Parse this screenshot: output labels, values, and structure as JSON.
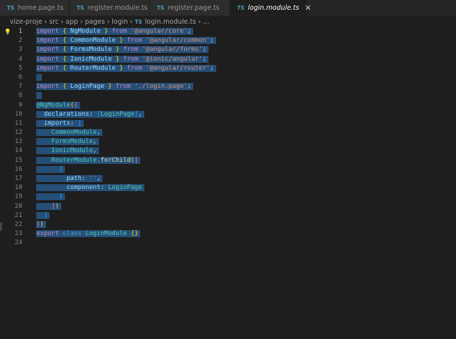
{
  "tabs": [
    {
      "icon": "TS",
      "label": "home.page.ts",
      "active": false
    },
    {
      "icon": "TS",
      "label": "register.module.ts",
      "active": false
    },
    {
      "icon": "TS",
      "label": "register.page.ts",
      "active": false
    },
    {
      "icon": "TS",
      "label": "login.module.ts",
      "active": true
    }
  ],
  "breadcrumb": {
    "items": [
      "vize-proje",
      "src",
      "app",
      "pages",
      "login"
    ],
    "file_icon": "TS",
    "file": "login.module.ts",
    "more": "..."
  },
  "code": [
    [
      [
        "import",
        "kw"
      ],
      [
        " ",
        "pl"
      ],
      [
        "{",
        "br1"
      ],
      [
        " NgModule ",
        "id"
      ],
      [
        "}",
        "br1"
      ],
      [
        " ",
        "pl"
      ],
      [
        "from",
        "kw"
      ],
      [
        " ",
        "pl"
      ],
      [
        "'@angular/core'",
        "str"
      ],
      [
        ";",
        "pl"
      ]
    ],
    [
      [
        "import",
        "kw"
      ],
      [
        " ",
        "pl"
      ],
      [
        "{",
        "br1"
      ],
      [
        " CommonModule ",
        "id"
      ],
      [
        "}",
        "br1"
      ],
      [
        " ",
        "pl"
      ],
      [
        "from",
        "kw"
      ],
      [
        " ",
        "pl"
      ],
      [
        "'@angular/common'",
        "str"
      ],
      [
        ";",
        "pl"
      ]
    ],
    [
      [
        "import",
        "kw"
      ],
      [
        " ",
        "pl"
      ],
      [
        "{",
        "br1"
      ],
      [
        " FormsModule ",
        "id"
      ],
      [
        "}",
        "br1"
      ],
      [
        " ",
        "pl"
      ],
      [
        "from",
        "kw"
      ],
      [
        " ",
        "pl"
      ],
      [
        "'@angular/forms'",
        "str"
      ],
      [
        ";",
        "pl"
      ]
    ],
    [
      [
        "import",
        "kw"
      ],
      [
        " ",
        "pl"
      ],
      [
        "{",
        "br1"
      ],
      [
        " IonicModule ",
        "id"
      ],
      [
        "}",
        "br1"
      ],
      [
        " ",
        "pl"
      ],
      [
        "from",
        "kw"
      ],
      [
        " ",
        "pl"
      ],
      [
        "'@ionic/angular'",
        "str"
      ],
      [
        ";",
        "pl"
      ]
    ],
    [
      [
        "import",
        "kw"
      ],
      [
        " ",
        "pl"
      ],
      [
        "{",
        "br1"
      ],
      [
        " RouterModule ",
        "id"
      ],
      [
        "}",
        "br1"
      ],
      [
        " ",
        "pl"
      ],
      [
        "from",
        "kw"
      ],
      [
        " ",
        "pl"
      ],
      [
        "'@angular/router'",
        "str"
      ],
      [
        ";",
        "pl"
      ]
    ],
    [],
    [
      [
        "import",
        "kw"
      ],
      [
        " ",
        "pl"
      ],
      [
        "{",
        "br1"
      ],
      [
        " LoginPage ",
        "id"
      ],
      [
        "}",
        "br1"
      ],
      [
        " ",
        "pl"
      ],
      [
        "from",
        "kw"
      ],
      [
        " ",
        "pl"
      ],
      [
        "'./login.page'",
        "str"
      ],
      [
        ";",
        "pl"
      ]
    ],
    [],
    [
      [
        "@NgModule",
        "dec"
      ],
      [
        "(",
        "br1"
      ],
      [
        "{",
        "br2"
      ]
    ],
    [
      [
        "  declarations",
        "id"
      ],
      [
        ": ",
        "pl"
      ],
      [
        "[",
        "br3"
      ],
      [
        "LoginPage",
        "cls"
      ],
      [
        "]",
        "br3"
      ],
      [
        ",",
        "pl"
      ]
    ],
    [
      [
        "  imports",
        "id"
      ],
      [
        ": ",
        "pl"
      ],
      [
        "[",
        "br3"
      ]
    ],
    [
      [
        "    CommonModule",
        "cls"
      ],
      [
        ",",
        "pl"
      ]
    ],
    [
      [
        "    FormsModule",
        "cls"
      ],
      [
        ",",
        "pl"
      ]
    ],
    [
      [
        "    IonicModule",
        "cls"
      ],
      [
        ",",
        "pl"
      ]
    ],
    [
      [
        "    RouterModule",
        "cls"
      ],
      [
        ".",
        "pl"
      ],
      [
        "forChild",
        "fn"
      ],
      [
        "(",
        "br1"
      ],
      [
        "[",
        "br2"
      ]
    ],
    [
      [
        "      ",
        "pl"
      ],
      [
        "{",
        "br3"
      ]
    ],
    [
      [
        "        path",
        "id"
      ],
      [
        ": ",
        "pl"
      ],
      [
        "''",
        "str"
      ],
      [
        ",",
        "pl"
      ]
    ],
    [
      [
        "        component",
        "id"
      ],
      [
        ": ",
        "pl"
      ],
      [
        "LoginPage",
        "cls"
      ]
    ],
    [
      [
        "      ",
        "pl"
      ],
      [
        "}",
        "br3"
      ]
    ],
    [
      [
        "    ",
        "pl"
      ],
      [
        "]",
        "br2"
      ],
      [
        ")",
        "br1"
      ]
    ],
    [
      [
        "  ",
        "pl"
      ],
      [
        "]",
        "br3"
      ]
    ],
    [
      [
        "}",
        "br2"
      ],
      [
        ")",
        "br1"
      ]
    ],
    [
      [
        "export",
        "kw"
      ],
      [
        " ",
        "pl"
      ],
      [
        "class",
        "kw2"
      ],
      [
        " ",
        "pl"
      ],
      [
        "LoginModule",
        "cls"
      ],
      [
        " ",
        "pl"
      ],
      [
        "{}",
        "br1"
      ]
    ],
    []
  ],
  "current_line": 1
}
